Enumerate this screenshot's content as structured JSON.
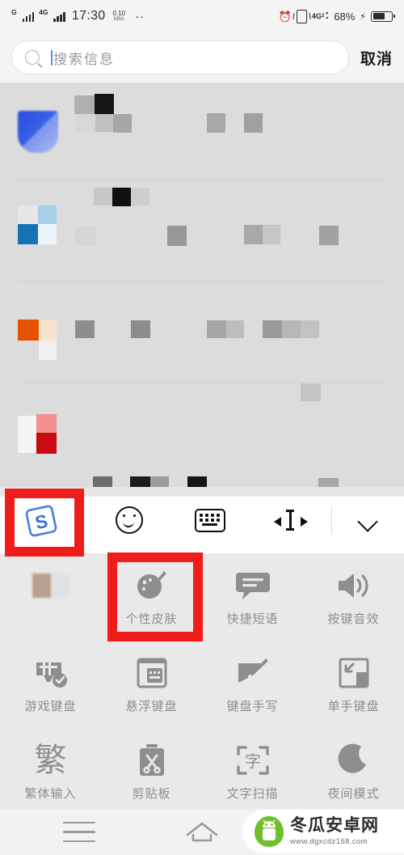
{
  "status_bar": {
    "carrier_1": "G",
    "carrier_2": "4G",
    "time": "17:30",
    "net_speed_value": "0.10",
    "net_speed_unit": "KB/s",
    "overflow_dots": "··",
    "alarm_icon": "alarm-clock-icon",
    "vibrate_icon": "vibrate-icon",
    "data_label": "4G",
    "data_sub": "2",
    "battery_percent": "68%",
    "charging_icon": "⚡",
    "battery_level_pct": 68
  },
  "search": {
    "placeholder": "搜索信息",
    "value": "",
    "cancel_label": "取消",
    "icon": "search-icon",
    "caret_color": "#3d9bf0"
  },
  "keyboard_toolbar": {
    "brand_icon": "sogou-logo-icon",
    "brand_letter": "S",
    "items": [
      {
        "name": "emoji-icon",
        "label": "表情"
      },
      {
        "name": "keyboard-icon",
        "label": "键盘"
      },
      {
        "name": "cursor-move-icon",
        "label": "移动光标"
      },
      {
        "name": "chevron-down-icon",
        "label": "收起"
      }
    ]
  },
  "function_panel": {
    "rows": [
      [
        {
          "label": "",
          "icon": "censored-icon",
          "censored": true
        },
        {
          "label": "个性皮肤",
          "icon": "palette-brush-icon",
          "highlighted": true
        },
        {
          "label": "快捷短语",
          "icon": "speech-bubble-icon"
        },
        {
          "label": "按键音效",
          "icon": "speaker-icon"
        }
      ],
      [
        {
          "label": "游戏键盘",
          "icon": "gamepad-check-icon"
        },
        {
          "label": "悬浮键盘",
          "icon": "floating-keyboard-icon"
        },
        {
          "label": "键盘手写",
          "icon": "handwriting-pen-icon"
        },
        {
          "label": "单手键盘",
          "icon": "one-hand-keyboard-icon"
        }
      ],
      [
        {
          "label": "繁体输入",
          "icon": "traditional-chinese-icon",
          "glyph_text": "繁"
        },
        {
          "label": "剪贴板",
          "icon": "clipboard-scissors-icon"
        },
        {
          "label": "文字扫描",
          "icon": "text-scan-icon",
          "glyph_text": "字"
        },
        {
          "label": "夜间模式",
          "icon": "moon-icon"
        }
      ]
    ]
  },
  "annotations": {
    "highlight_color": "#ef1c1c",
    "boxes": [
      {
        "name": "sogou-logo-highlight",
        "target": "sogou-logo-icon"
      },
      {
        "name": "skin-button-highlight",
        "target": "个性皮肤"
      }
    ]
  },
  "nav_bar": {
    "recents_icon": "recents-menu-icon",
    "home_icon": "home-icon"
  },
  "watermark": {
    "site_name": "冬瓜安卓网",
    "url": "www.dgxcdz168.com",
    "logo_icon": "android-melon-logo-icon",
    "logo_color": "#6fc02c"
  }
}
